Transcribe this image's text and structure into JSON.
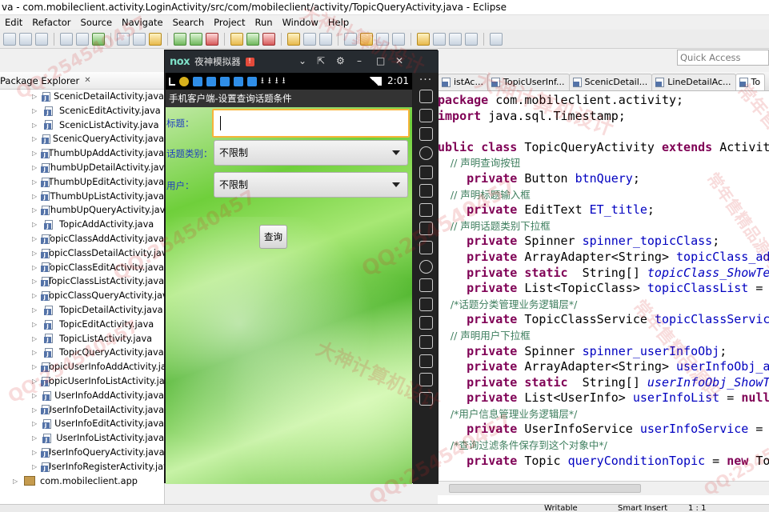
{
  "window": {
    "title": "va - com.mobileclient.activity.LoginActivity/src/com/mobileclient/activity/TopicQueryActivity.java - Eclipse"
  },
  "menu": [
    "Edit",
    "Refactor",
    "Source",
    "Navigate",
    "Search",
    "Project",
    "Run",
    "Window",
    "Help"
  ],
  "quick_access": {
    "placeholder": "Quick Access"
  },
  "package_explorer": {
    "title": "Package Explorer",
    "items": [
      "ScenicDetailActivity.java",
      "ScenicEditActivity.java",
      "ScenicListActivity.java",
      "ScenicQueryActivity.java",
      "ThumbUpAddActivity.java",
      "ThumbUpDetailActivity.java",
      "ThumbUpEditActivity.java",
      "ThumbUpListActivity.java",
      "ThumbUpQueryActivity.java",
      "TopicAddActivity.java",
      "TopicClassAddActivity.java",
      "TopicClassDetailActivity.java",
      "TopicClassEditActivity.java",
      "TopicClassListActivity.java",
      "TopicClassQueryActivity.java",
      "TopicDetailActivity.java",
      "TopicEditActivity.java",
      "TopicListActivity.java",
      "TopicQueryActivity.java",
      "TopicUserInfoAddActivity.java",
      "TopicUserInfoListActivity.java",
      "UserInfoAddActivity.java",
      "UserInfoDetailActivity.java",
      "UserInfoEditActivity.java",
      "UserInfoListActivity.java",
      "UserInfoQueryActivity.java",
      "UserInfoRegisterActivity.java"
    ],
    "package_node": "com.mobileclient.app"
  },
  "editor": {
    "tabs": [
      "istAc...",
      "TopicUserInf...",
      "ScenicDetail...",
      "LineDetailAc...",
      "To"
    ],
    "code_lines": [
      [
        {
          "t": "package",
          "c": "kw"
        },
        {
          "t": " com.mobileclient.activity;"
        }
      ],
      [
        {
          "t": "import",
          "c": "kw"
        },
        {
          "t": " java.sql.Timestamp;"
        }
      ],
      [],
      [
        {
          "t": "ublic ",
          "c": "kw"
        },
        {
          "t": "class",
          "c": "kw"
        },
        {
          "t": " TopicQueryActivity "
        },
        {
          "t": "extends",
          "c": "kw"
        },
        {
          "t": " Activit"
        }
      ],
      [
        {
          "t": "    // 声明查询按钮",
          "c": "cm"
        }
      ],
      [
        {
          "t": "    "
        },
        {
          "t": "private",
          "c": "kw"
        },
        {
          "t": " Button "
        },
        {
          "t": "btnQuery",
          "c": "fld"
        },
        {
          "t": ";"
        }
      ],
      [
        {
          "t": "    // 声明标题输入框",
          "c": "cm"
        }
      ],
      [
        {
          "t": "    "
        },
        {
          "t": "private",
          "c": "kw"
        },
        {
          "t": " EditText "
        },
        {
          "t": "ET_title",
          "c": "fld"
        },
        {
          "t": ";"
        }
      ],
      [
        {
          "t": "    // 声明话题类别下拉框",
          "c": "cm"
        }
      ],
      [
        {
          "t": "    "
        },
        {
          "t": "private",
          "c": "kw"
        },
        {
          "t": " Spinner "
        },
        {
          "t": "spinner_topicClass",
          "c": "fld"
        },
        {
          "t": ";"
        }
      ],
      [
        {
          "t": "    "
        },
        {
          "t": "private",
          "c": "kw"
        },
        {
          "t": " ArrayAdapter<String> "
        },
        {
          "t": "topicClass_ada",
          "c": "fld"
        }
      ],
      [
        {
          "t": "    "
        },
        {
          "t": "private",
          "c": "kw"
        },
        {
          "t": " "
        },
        {
          "t": "static",
          "c": "kw"
        },
        {
          "t": "  String[] "
        },
        {
          "t": "topicClass_ShowTex",
          "c": "sfld"
        }
      ],
      [
        {
          "t": "    "
        },
        {
          "t": "private",
          "c": "kw"
        },
        {
          "t": " List<TopicClass> "
        },
        {
          "t": "topicClassList",
          "c": "fld"
        },
        {
          "t": " = nu"
        }
      ],
      [
        {
          "t": "    /*话题分类管理业务逻辑层*/",
          "c": "cm"
        }
      ],
      [
        {
          "t": "    "
        },
        {
          "t": "private",
          "c": "kw"
        },
        {
          "t": " TopicClassService "
        },
        {
          "t": "topicClassService",
          "c": "fld"
        }
      ],
      [
        {
          "t": "    // 声明用户下拉框",
          "c": "cm"
        }
      ],
      [
        {
          "t": "    "
        },
        {
          "t": "private",
          "c": "kw"
        },
        {
          "t": " Spinner "
        },
        {
          "t": "spinner_userInfoObj",
          "c": "fld"
        },
        {
          "t": ";"
        }
      ],
      [
        {
          "t": "    "
        },
        {
          "t": "private",
          "c": "kw"
        },
        {
          "t": " ArrayAdapter<String> "
        },
        {
          "t": "userInfoObj_ad",
          "c": "fld"
        }
      ],
      [
        {
          "t": "    "
        },
        {
          "t": "private",
          "c": "kw"
        },
        {
          "t": " "
        },
        {
          "t": "static",
          "c": "kw"
        },
        {
          "t": "  String[] "
        },
        {
          "t": "userInfoObj_ShowTe",
          "c": "sfld"
        }
      ],
      [
        {
          "t": "    "
        },
        {
          "t": "private",
          "c": "kw"
        },
        {
          "t": " List<UserInfo> "
        },
        {
          "t": "userInfoList",
          "c": "fld"
        },
        {
          "t": " = "
        },
        {
          "t": "null",
          "c": "kw"
        },
        {
          "t": ";"
        }
      ],
      [
        {
          "t": "    /*用户信息管理业务逻辑层*/",
          "c": "cm"
        }
      ],
      [
        {
          "t": "    "
        },
        {
          "t": "private",
          "c": "kw"
        },
        {
          "t": " UserInfoService "
        },
        {
          "t": "userInfoService",
          "c": "fld"
        },
        {
          "t": " = n"
        }
      ],
      [
        {
          "t": "    /*查询过滤条件保存到这个对象中*/",
          "c": "cm"
        }
      ],
      [
        {
          "t": "    "
        },
        {
          "t": "private",
          "c": "kw"
        },
        {
          "t": " Topic "
        },
        {
          "t": "queryConditionTopic",
          "c": "fld"
        },
        {
          "t": " = "
        },
        {
          "t": "new",
          "c": "kw"
        },
        {
          "t": " Top"
        }
      ]
    ]
  },
  "status": {
    "writable": "Writable",
    "insert_mode": "Smart Insert",
    "position": "1 : 1"
  },
  "emulator": {
    "logo": "nox",
    "name": "夜神模拟器",
    "badge": "!",
    "time": "2:01",
    "app_title": "手机客户端-设置查询话题条件",
    "form": {
      "title_label": "标题：",
      "title_value": "",
      "topic_class_label": "话题类别：",
      "topic_class_value": "不限制",
      "user_label": "用户：",
      "user_value": "不限制",
      "query_button": "查询"
    }
  },
  "watermarks": [
    "QQ:254540457",
    "大神计算机设计",
    "常年售精品源码",
    "QQ:254540457",
    "大神计算机设计",
    "常年售精品源码",
    "QQ:254540457",
    "QQ:254540457",
    "大神计算机设计",
    "QQ:254540457",
    "常年售精品源码",
    "QQ:254540457"
  ],
  "colors": {
    "eclipse_bg": "#f0f0f0",
    "keyword": "#7f0055",
    "comment": "#3f7f5f",
    "field": "#0000c0",
    "nox_frame": "#262b30",
    "focus": "#f7b43a"
  }
}
